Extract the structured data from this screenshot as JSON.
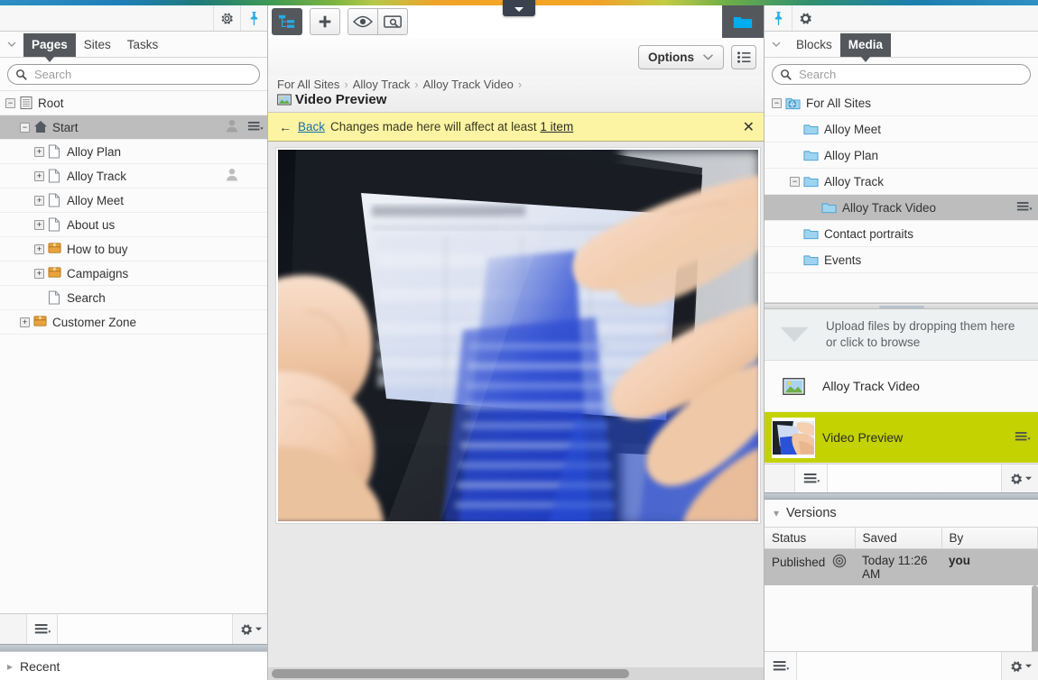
{
  "app": {
    "accent": "#c3d200",
    "selection_gray": "#bdbdbd",
    "notice_yellow": "#fcf4a3"
  },
  "left_panel": {
    "topbar": {
      "gear_icon": "gear-icon",
      "pin_icon": "pin-icon"
    },
    "tabs": [
      {
        "label": "Pages",
        "active": true
      },
      {
        "label": "Sites",
        "active": false
      },
      {
        "label": "Tasks",
        "active": false
      }
    ],
    "search": {
      "value": "",
      "placeholder": "Search",
      "icon": "search-icon"
    },
    "tree": [
      {
        "label": "Root",
        "indent": 0,
        "expander": "minus",
        "icon": "root-icon",
        "user": false,
        "selected": false,
        "menu": false
      },
      {
        "label": "Start",
        "indent": 1,
        "expander": "minus",
        "icon": "home-icon",
        "user": true,
        "selected": true,
        "menu": true
      },
      {
        "label": "Alloy Plan",
        "indent": 2,
        "expander": "plus",
        "icon": "page-icon",
        "user": false,
        "selected": false,
        "menu": false
      },
      {
        "label": "Alloy Track",
        "indent": 2,
        "expander": "plus",
        "icon": "page-icon",
        "user": true,
        "selected": false,
        "menu": false
      },
      {
        "label": "Alloy Meet",
        "indent": 2,
        "expander": "plus",
        "icon": "page-icon",
        "user": false,
        "selected": false,
        "menu": false
      },
      {
        "label": "About us",
        "indent": 2,
        "expander": "plus",
        "icon": "page-icon",
        "user": false,
        "selected": false,
        "menu": false
      },
      {
        "label": "How to buy",
        "indent": 2,
        "expander": "plus",
        "icon": "container-icon",
        "user": false,
        "selected": false,
        "menu": false
      },
      {
        "label": "Campaigns",
        "indent": 2,
        "expander": "plus",
        "icon": "container-icon",
        "user": false,
        "selected": false,
        "menu": false
      },
      {
        "label": "Search",
        "indent": 2,
        "expander": "none",
        "icon": "page-icon",
        "user": false,
        "selected": false,
        "menu": false
      },
      {
        "label": "Customer Zone",
        "indent": 1,
        "expander": "plus",
        "icon": "container-icon",
        "user": false,
        "selected": false,
        "menu": false
      }
    ],
    "footer": {
      "menu_icon": "list-menu-icon",
      "gear_icon": "gear-icon"
    },
    "recent": {
      "label": "Recent",
      "chevron": "chevron-right-icon"
    }
  },
  "center": {
    "toolbar": {
      "site_tree_icon": "site-tree-icon",
      "add_icon": "plus-icon",
      "view_icon": "eye-icon",
      "preview_icon": "preview-search-icon",
      "assets_icon": "folder-icon",
      "collapse_icon": "chevron-down-icon"
    },
    "options_button": {
      "label": "Options",
      "chevron": "chevron-down-icon"
    },
    "view_list_button": {
      "icon": "list-view-icon"
    },
    "breadcrumb": [
      "For All Sites",
      "Alloy Track",
      "Alloy Track Video"
    ],
    "page_title": "Video Preview",
    "page_title_icon": "image-block-icon",
    "notice": {
      "back_arrow": "arrow-left-icon",
      "back_label": "Back",
      "message_before": "Changes made here will affect at least",
      "count_link": "1 item",
      "close_icon": "close-icon"
    },
    "preview": {
      "alt": "Hands touching a tablet showing a budget spreadsheet"
    }
  },
  "right_panel": {
    "topbar": {
      "pin_icon": "pin-icon",
      "gear_icon": "gear-icon"
    },
    "tabs": [
      {
        "label": "Blocks",
        "active": false
      },
      {
        "label": "Media",
        "active": true
      }
    ],
    "search": {
      "value": "",
      "placeholder": "Search",
      "icon": "search-icon"
    },
    "tree": [
      {
        "label": "For All Sites",
        "indent": 0,
        "expander": "minus",
        "icon": "globe-folder-icon",
        "selected": false,
        "menu": false
      },
      {
        "label": "Alloy Meet",
        "indent": 1,
        "expander": "none",
        "icon": "folder-icon",
        "selected": false,
        "menu": false
      },
      {
        "label": "Alloy Plan",
        "indent": 1,
        "expander": "none",
        "icon": "folder-icon",
        "selected": false,
        "menu": false
      },
      {
        "label": "Alloy Track",
        "indent": 1,
        "expander": "minus",
        "icon": "folder-icon",
        "selected": false,
        "menu": false
      },
      {
        "label": "Alloy Track Video",
        "indent": 2,
        "expander": "none",
        "icon": "folder-icon",
        "selected": true,
        "menu": true
      },
      {
        "label": "Contact portraits",
        "indent": 1,
        "expander": "none",
        "icon": "folder-icon",
        "selected": false,
        "menu": false
      },
      {
        "label": "Events",
        "indent": 1,
        "expander": "none",
        "icon": "folder-icon",
        "selected": false,
        "menu": false
      }
    ],
    "upload": {
      "icon": "download-arrow-icon",
      "line1": "Upload files by dropping them here",
      "line2": "or click to browse"
    },
    "media_items": [
      {
        "name": "Alloy Track Video",
        "thumb": "video-block-icon",
        "selected": false,
        "menu": false
      },
      {
        "name": "Video Preview",
        "thumb": "photo-thumbnail",
        "selected": true,
        "menu": true
      }
    ],
    "media_footer": {
      "menu_icon": "list-menu-icon",
      "gear_icon": "gear-icon"
    },
    "versions": {
      "header_label": "Versions",
      "chevron": "chevron-down-icon",
      "columns": [
        "Status",
        "Saved",
        "By"
      ],
      "rows": [
        {
          "status": "Published",
          "status_icon": "published-icon",
          "saved": "Today 11:26 AM",
          "by": "you",
          "selected": true
        }
      ],
      "footer": {
        "menu_icon": "list-menu-icon",
        "gear_icon": "gear-icon"
      }
    }
  }
}
